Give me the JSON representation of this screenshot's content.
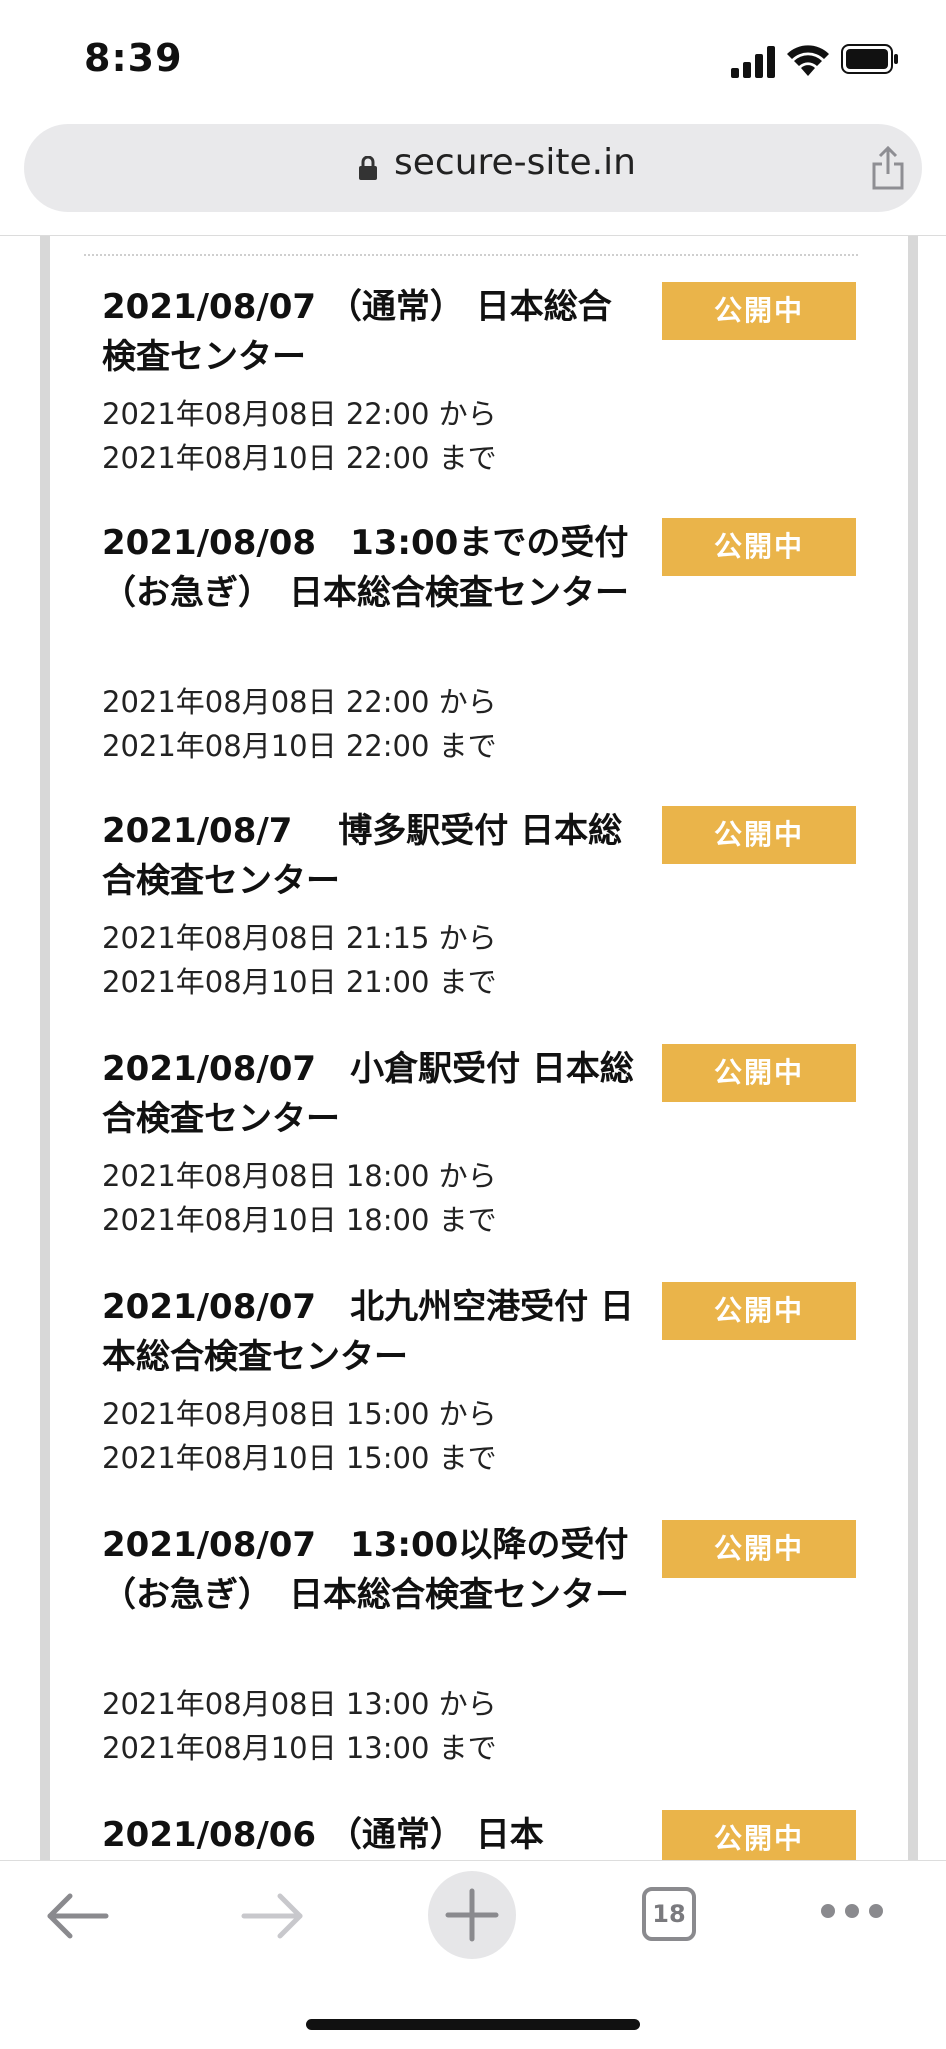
{
  "status_bar": {
    "time": "8:39"
  },
  "browser": {
    "url": "secure-site.in",
    "tab_count": "18"
  },
  "entries": [
    {
      "title": "2021/08/07 （通常） 日本総合検査センター",
      "from": "2021年08月08日 22:00 から",
      "until": "2021年08月10日 22:00 まで",
      "status": "公開中"
    },
    {
      "title": "2021/08/08　13:00までの受付（お急ぎ）　日本総合検査センター",
      "from": "2021年08月08日 22:00 から",
      "until": "2021年08月10日 22:00 まで",
      "status": "公開中"
    },
    {
      "title": "2021/08/7　 博多駅受付 日本総合検査センター",
      "from": "2021年08月08日 21:15 から",
      "until": "2021年08月10日 21:00 まで",
      "status": "公開中"
    },
    {
      "title": "2021/08/07　小倉駅受付 日本総合検査センター",
      "from": "2021年08月08日 18:00 から",
      "until": "2021年08月10日 18:00 まで",
      "status": "公開中"
    },
    {
      "title": "2021/08/07　北九州空港受付 日本総合検査センター",
      "from": "2021年08月08日 15:00 から",
      "until": "2021年08月10日 15:00 まで",
      "status": "公開中"
    },
    {
      "title": "2021/08/07　13:00以降の受付（お急ぎ）　日本総合検査センター",
      "from": "2021年08月08日 13:00 から",
      "until": "2021年08月10日 13:00 まで",
      "status": "公開中"
    },
    {
      "title": "2021/08/06 （通常） 日本",
      "from": "",
      "until": "",
      "status": "公開中"
    }
  ],
  "colors": {
    "badge": "#eab44a",
    "url_bar": "#e9e9eb",
    "frame_border": "#d8d8d8"
  },
  "icons": {
    "toolbar": [
      "back-arrow-icon",
      "forward-arrow-icon",
      "new-tab-plus-icon",
      "tab-count-icon",
      "more-dots-icon"
    ],
    "url_bar": [
      "lock-icon",
      "share-icon"
    ]
  }
}
